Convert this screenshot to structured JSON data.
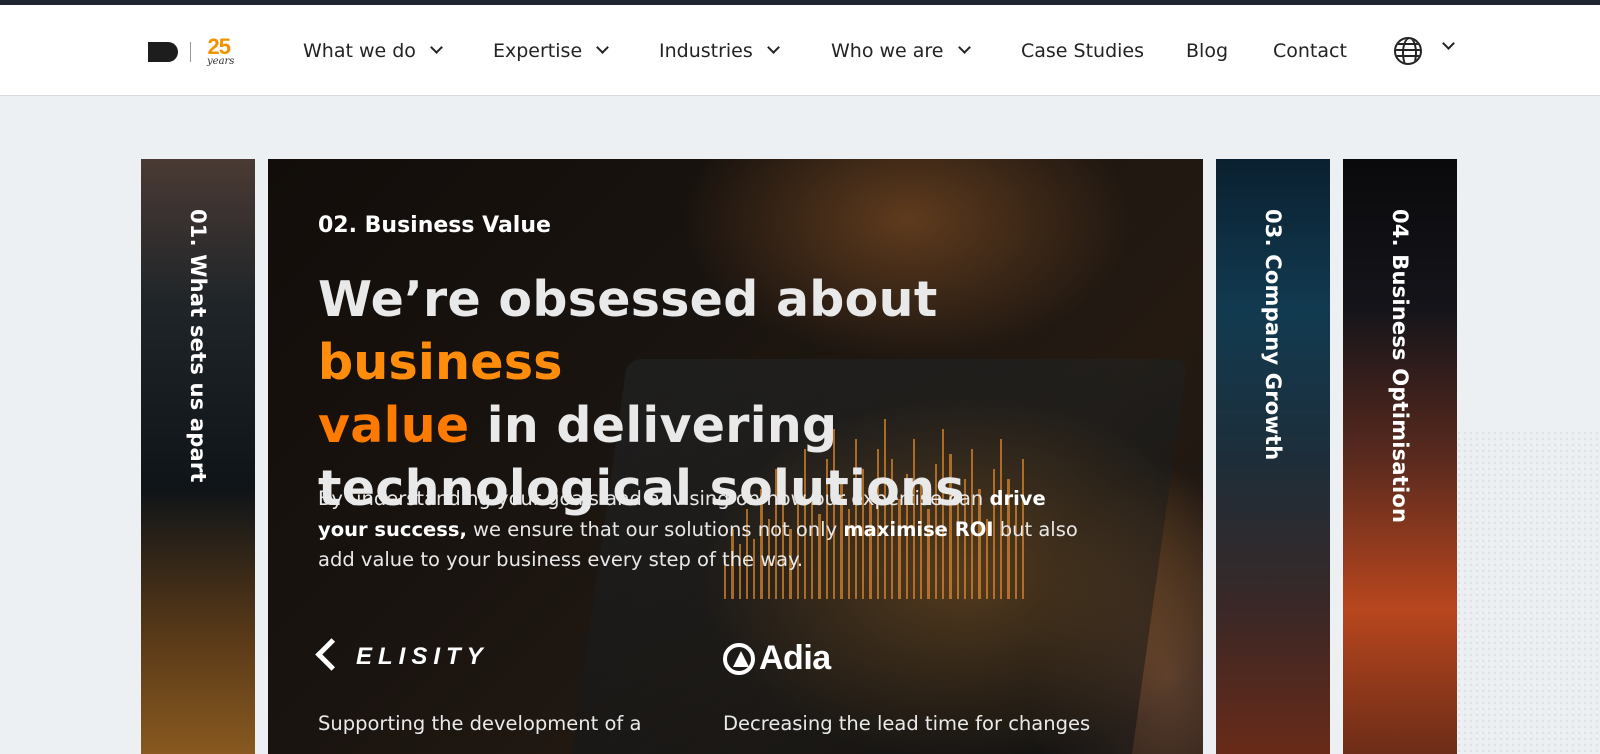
{
  "header": {
    "logo": {
      "years_number": "25",
      "years_word": "years"
    },
    "nav": [
      {
        "label": "What we do",
        "dropdown": true
      },
      {
        "label": "Expertise",
        "dropdown": true
      },
      {
        "label": "Industries",
        "dropdown": true
      },
      {
        "label": "Who we are",
        "dropdown": true
      },
      {
        "label": "Case Studies",
        "dropdown": false
      },
      {
        "label": "Blog",
        "dropdown": false
      },
      {
        "label": "Contact",
        "dropdown": false
      }
    ],
    "language_icon": "globe-icon"
  },
  "slider": {
    "panels": [
      {
        "label": "01. What sets us apart"
      },
      {
        "label": "02. Business Value",
        "active": true
      },
      {
        "label": "03. Company Growth"
      },
      {
        "label": "04. Business Optimisation"
      }
    ],
    "active": {
      "tag": "02. Business Value",
      "headline": {
        "part1": "We’re obsessed about ",
        "accent1": "business",
        "accent2": "value",
        "part2": " in delivering technological solutions"
      },
      "description": {
        "t1": "By understanding your goals and advising on how our expertise can ",
        "b1": "drive your success,",
        "t2": " we ensure that our solutions not only ",
        "b2": "maximise ROI",
        "t3": " but also add value to your business every step of the way."
      },
      "cases": [
        {
          "brand": "ELISITY",
          "text": "Supporting the development of a"
        },
        {
          "brand": "Adia",
          "text": "Decreasing the lead time for changes"
        }
      ]
    }
  },
  "colors": {
    "accent": "#ff7a00",
    "header_bg": "#ffffff",
    "page_bg": "#edf0f3"
  }
}
